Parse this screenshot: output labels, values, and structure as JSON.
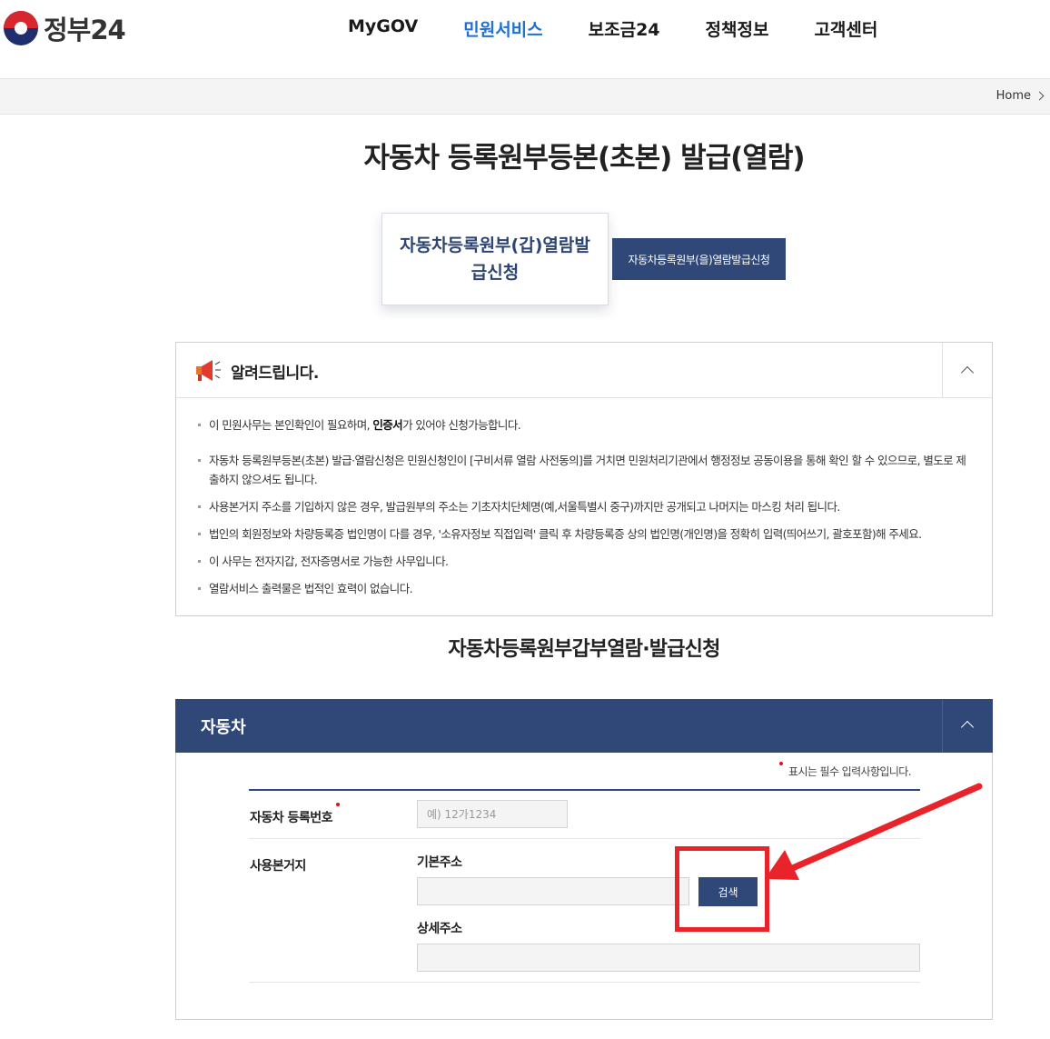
{
  "header": {
    "logo_text": "정부24",
    "nav": [
      "MyGOV",
      "민원서비스",
      "보조금24",
      "정책정보",
      "고객센터"
    ],
    "active_nav": "민원서비스"
  },
  "breadcrumb": {
    "home": "Home"
  },
  "page_title": "자동차 등록원부등본(초본) 발급(열람)",
  "tabs": {
    "active": "자동차등록원부(갑)열람발급신청",
    "inactive": "자동차등록원부(을)열람발급신청"
  },
  "notice": {
    "title": "알려드립니다.",
    "items": [
      {
        "pre": "이 민원사무는 본인확인이 필요하며, ",
        "bold": "인증서",
        "post": "가 있어야 신청가능합니다."
      },
      {
        "pre": "자동차 등록원부등본(초본) 발급·열람신청은 민원신청인이 [구비서류 열람 사전동의]를 거치면 민원처리기관에서 행정정보 공동이용을 통해 확인 할 수 있으므로, 별도로 제출하지 않으셔도 됩니다.",
        "bold": "",
        "post": ""
      },
      {
        "pre": "사용본거지 주소를 기입하지 않은 경우, 발급원부의 주소는 기초자치단체명(예,서울특별시 중구)까지만 공개되고 나머지는 마스킹 처리 됩니다.",
        "bold": "",
        "post": ""
      },
      {
        "pre": "법인의 회원정보와 차량등록증 법인명이 다를 경우, '소유자정보 직접입력' 클릭 후 차량등록증 상의 법인명(개인명)을 정확히 입력(띄어쓰기, 괄호포함)해 주세요.",
        "bold": "",
        "post": ""
      },
      {
        "pre": "이 사무는 전자지갑, 전자증명서로 가능한 사무입니다.",
        "bold": "",
        "post": ""
      },
      {
        "pre": "열람서비스 출력물은 법적인 효력이 없습니다.",
        "bold": "",
        "post": ""
      }
    ]
  },
  "sub_title": "자동차등록원부갑부열람·발급신청",
  "vehicle": {
    "section_title": "자동차",
    "required_note": "표시는 필수 입력사항입니다.",
    "reg_number_label": "자동차 등록번호",
    "reg_number_placeholder": "예) 12가1234",
    "reg_number_value": "",
    "base_location_label": "사용본거지",
    "basic_address_label": "기본주소",
    "basic_address_value": "",
    "search_button": "검색",
    "detail_address_label": "상세주소",
    "detail_address_value": ""
  },
  "icons": {
    "logo": "taegeuk-emblem-icon",
    "notice": "megaphone-icon",
    "collapse": "chevron-up-icon",
    "breadcrumb": "chevron-right-icon"
  },
  "colors": {
    "brand_navy": "#2f4877",
    "active_nav": "#1f6fd6",
    "required_dot": "#e0121b",
    "annotation": "#e8232a"
  }
}
